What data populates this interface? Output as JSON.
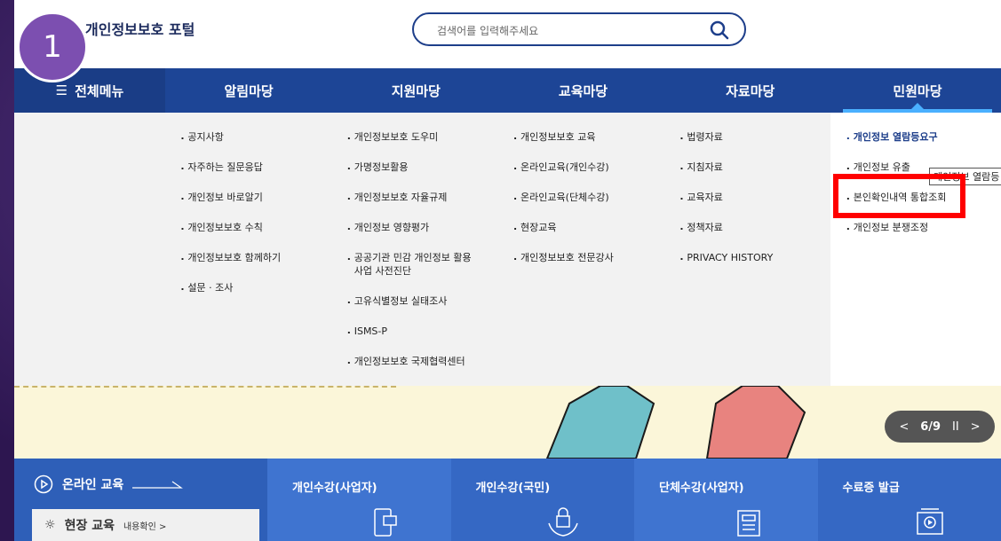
{
  "step": "1",
  "header": {
    "logo": "개인정보보호 포털",
    "search_placeholder": "검색어를 입력해주세요"
  },
  "nav": {
    "all_menu": "전체메뉴",
    "items": [
      "알림마당",
      "지원마당",
      "교육마당",
      "자료마당",
      "민원마당"
    ]
  },
  "dropdown": {
    "col1": [
      "공지사항",
      "자주하는 질문응답",
      "개인정보 바로알기",
      "개인정보보호 수칙",
      "개인정보보호 함께하기",
      "설문 · 조사"
    ],
    "col2": [
      "개인정보보호 도우미",
      "가명정보활용",
      "개인정보보호 자율규제",
      "개인정보 영향평가",
      "공공기관 민감 개인정보 활용사업 사전진단",
      "고유식별정보 실태조사",
      "ISMS-P",
      "개인정보보호 국제협력센터"
    ],
    "col3": [
      "개인정보보호 교육",
      "온라인교육(개인수강)",
      "온라인교육(단체수강)",
      "현장교육",
      "개인정보보호 전문강사"
    ],
    "col4": [
      "법령자료",
      "지침자료",
      "교육자료",
      "정책자료",
      "PRIVACY HISTORY"
    ],
    "col5": [
      "개인정보 열람등요구",
      "개인정보 유출",
      "본인확인내역 통합조회",
      "개인정보 분쟁조정"
    ],
    "tooltip": "개인정보 열람등"
  },
  "banner": {
    "slide_counter": "6/9"
  },
  "quick": {
    "online": "온라인 교육",
    "onsite": "현장 교육",
    "onsite_link": "내용확인 >",
    "items": [
      "개인수강(사업자)",
      "개인수강(국민)",
      "단체수강(사업자)",
      "수료증 발급"
    ]
  },
  "colors": {
    "nav_bg": "#1d4596",
    "highlight": "#ff0000",
    "badge": "#7c4fb0"
  }
}
